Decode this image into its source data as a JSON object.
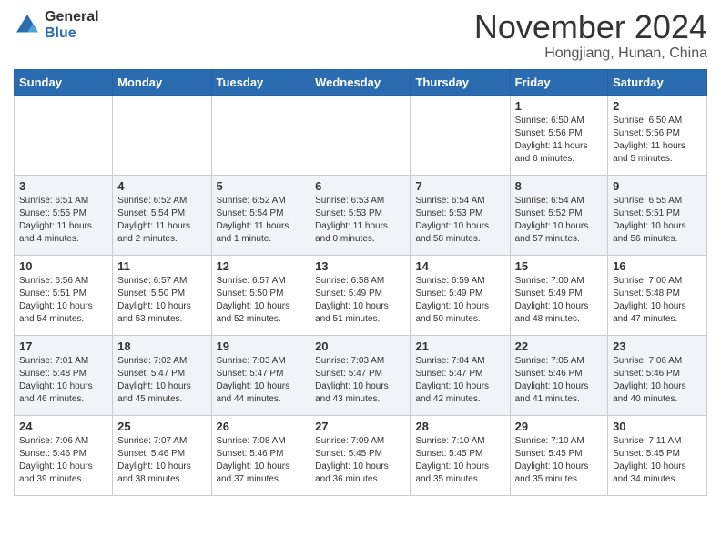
{
  "header": {
    "logo_general": "General",
    "logo_blue": "Blue",
    "month_title": "November 2024",
    "subtitle": "Hongjiang, Hunan, China"
  },
  "weekdays": [
    "Sunday",
    "Monday",
    "Tuesday",
    "Wednesday",
    "Thursday",
    "Friday",
    "Saturday"
  ],
  "weeks": [
    {
      "days": [
        {
          "num": "",
          "info": ""
        },
        {
          "num": "",
          "info": ""
        },
        {
          "num": "",
          "info": ""
        },
        {
          "num": "",
          "info": ""
        },
        {
          "num": "",
          "info": ""
        },
        {
          "num": "1",
          "info": "Sunrise: 6:50 AM\nSunset: 5:56 PM\nDaylight: 11 hours\nand 6 minutes."
        },
        {
          "num": "2",
          "info": "Sunrise: 6:50 AM\nSunset: 5:56 PM\nDaylight: 11 hours\nand 5 minutes."
        }
      ]
    },
    {
      "days": [
        {
          "num": "3",
          "info": "Sunrise: 6:51 AM\nSunset: 5:55 PM\nDaylight: 11 hours\nand 4 minutes."
        },
        {
          "num": "4",
          "info": "Sunrise: 6:52 AM\nSunset: 5:54 PM\nDaylight: 11 hours\nand 2 minutes."
        },
        {
          "num": "5",
          "info": "Sunrise: 6:52 AM\nSunset: 5:54 PM\nDaylight: 11 hours\nand 1 minute."
        },
        {
          "num": "6",
          "info": "Sunrise: 6:53 AM\nSunset: 5:53 PM\nDaylight: 11 hours\nand 0 minutes."
        },
        {
          "num": "7",
          "info": "Sunrise: 6:54 AM\nSunset: 5:53 PM\nDaylight: 10 hours\nand 58 minutes."
        },
        {
          "num": "8",
          "info": "Sunrise: 6:54 AM\nSunset: 5:52 PM\nDaylight: 10 hours\nand 57 minutes."
        },
        {
          "num": "9",
          "info": "Sunrise: 6:55 AM\nSunset: 5:51 PM\nDaylight: 10 hours\nand 56 minutes."
        }
      ]
    },
    {
      "days": [
        {
          "num": "10",
          "info": "Sunrise: 6:56 AM\nSunset: 5:51 PM\nDaylight: 10 hours\nand 54 minutes."
        },
        {
          "num": "11",
          "info": "Sunrise: 6:57 AM\nSunset: 5:50 PM\nDaylight: 10 hours\nand 53 minutes."
        },
        {
          "num": "12",
          "info": "Sunrise: 6:57 AM\nSunset: 5:50 PM\nDaylight: 10 hours\nand 52 minutes."
        },
        {
          "num": "13",
          "info": "Sunrise: 6:58 AM\nSunset: 5:49 PM\nDaylight: 10 hours\nand 51 minutes."
        },
        {
          "num": "14",
          "info": "Sunrise: 6:59 AM\nSunset: 5:49 PM\nDaylight: 10 hours\nand 50 minutes."
        },
        {
          "num": "15",
          "info": "Sunrise: 7:00 AM\nSunset: 5:49 PM\nDaylight: 10 hours\nand 48 minutes."
        },
        {
          "num": "16",
          "info": "Sunrise: 7:00 AM\nSunset: 5:48 PM\nDaylight: 10 hours\nand 47 minutes."
        }
      ]
    },
    {
      "days": [
        {
          "num": "17",
          "info": "Sunrise: 7:01 AM\nSunset: 5:48 PM\nDaylight: 10 hours\nand 46 minutes."
        },
        {
          "num": "18",
          "info": "Sunrise: 7:02 AM\nSunset: 5:47 PM\nDaylight: 10 hours\nand 45 minutes."
        },
        {
          "num": "19",
          "info": "Sunrise: 7:03 AM\nSunset: 5:47 PM\nDaylight: 10 hours\nand 44 minutes."
        },
        {
          "num": "20",
          "info": "Sunrise: 7:03 AM\nSunset: 5:47 PM\nDaylight: 10 hours\nand 43 minutes."
        },
        {
          "num": "21",
          "info": "Sunrise: 7:04 AM\nSunset: 5:47 PM\nDaylight: 10 hours\nand 42 minutes."
        },
        {
          "num": "22",
          "info": "Sunrise: 7:05 AM\nSunset: 5:46 PM\nDaylight: 10 hours\nand 41 minutes."
        },
        {
          "num": "23",
          "info": "Sunrise: 7:06 AM\nSunset: 5:46 PM\nDaylight: 10 hours\nand 40 minutes."
        }
      ]
    },
    {
      "days": [
        {
          "num": "24",
          "info": "Sunrise: 7:06 AM\nSunset: 5:46 PM\nDaylight: 10 hours\nand 39 minutes."
        },
        {
          "num": "25",
          "info": "Sunrise: 7:07 AM\nSunset: 5:46 PM\nDaylight: 10 hours\nand 38 minutes."
        },
        {
          "num": "26",
          "info": "Sunrise: 7:08 AM\nSunset: 5:46 PM\nDaylight: 10 hours\nand 37 minutes."
        },
        {
          "num": "27",
          "info": "Sunrise: 7:09 AM\nSunset: 5:45 PM\nDaylight: 10 hours\nand 36 minutes."
        },
        {
          "num": "28",
          "info": "Sunrise: 7:10 AM\nSunset: 5:45 PM\nDaylight: 10 hours\nand 35 minutes."
        },
        {
          "num": "29",
          "info": "Sunrise: 7:10 AM\nSunset: 5:45 PM\nDaylight: 10 hours\nand 35 minutes."
        },
        {
          "num": "30",
          "info": "Sunrise: 7:11 AM\nSunset: 5:45 PM\nDaylight: 10 hours\nand 34 minutes."
        }
      ]
    }
  ]
}
